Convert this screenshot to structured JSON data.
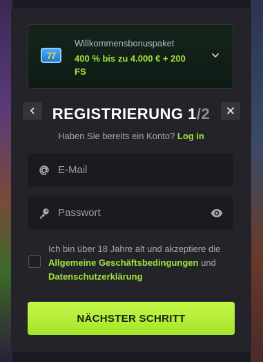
{
  "bonus": {
    "title": "Willkommensbonuspaket",
    "value": "400 % bis zu 4.000 € + 200 FS",
    "icon": "slot-777-icon",
    "icon_text": "77"
  },
  "header": {
    "title": "REGISTRIERUNG",
    "step_current": "1",
    "step_separator": "/",
    "step_total": "2"
  },
  "login": {
    "prompt": "Haben Sie bereits ein Konto?",
    "link": "Log in"
  },
  "form": {
    "email_placeholder": "E-Mail",
    "password_placeholder": "Passwort"
  },
  "terms": {
    "part1": "Ich bin über 18 Jahre alt und akzeptiere die",
    "link1": "Allgemeine Geschäftsbedingungen",
    "part2": "und",
    "link2": "Datenschutzerklärung"
  },
  "cta": {
    "label": "NÄCHSTER SCHRITT"
  },
  "colors": {
    "accent": "#9ee63a",
    "modal_bg": "#232329",
    "field_bg": "#1a1a1f",
    "cta_bg": "#b5ee39"
  }
}
